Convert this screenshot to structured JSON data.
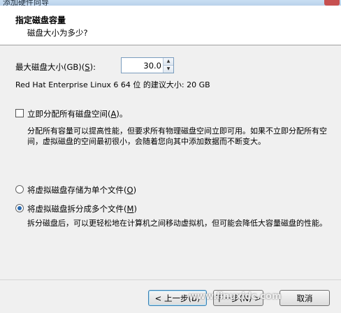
{
  "window": {
    "title": "添加硬件向导"
  },
  "header": {
    "title": "指定磁盘容量",
    "subtitle": "磁盘大小为多少?"
  },
  "disk_size": {
    "label_pre": "最大磁盘大小(GB)(",
    "label_key": "S",
    "label_post": "):",
    "value": "30.0",
    "recommend": "Red Hat Enterprise Linux 6 64 位 的建议大小: 20 GB"
  },
  "allocate": {
    "label_pre": "立即分配所有磁盘空间(",
    "label_key": "A",
    "label_post": ")。",
    "checked": false,
    "description": "分配所有容量可以提高性能，但要求所有物理磁盘空间立即可用。如果不立即分配所有空间，虚拟磁盘的空间最初很小，会随着您向其中添加数据而不断变大。"
  },
  "storage": {
    "single_pre": "将虚拟磁盘存储为单个文件(",
    "single_key": "O",
    "single_post": ")",
    "multi_pre": "将虚拟磁盘拆分成多个文件(",
    "multi_key": "M",
    "multi_post": ")",
    "selected": "multi",
    "multi_description": "拆分磁盘后，可以更轻松地在计算机之间移动虚拟机，但可能会降低大容量磁盘的性能。"
  },
  "footer": {
    "back": "< 上一步(B)",
    "next": "下一步(N) >",
    "cancel": "取消"
  },
  "watermark": "www.linuxidc.com"
}
